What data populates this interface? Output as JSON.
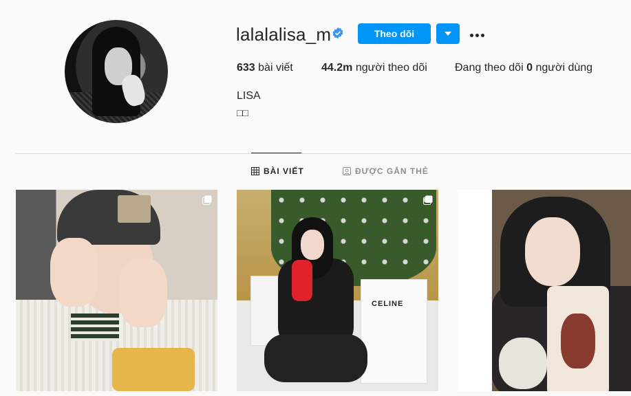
{
  "profile": {
    "username": "lalalalisa_m",
    "verified": true,
    "follow_label": "Theo dõi",
    "full_name": "LISA",
    "bio": "□□"
  },
  "stats": {
    "posts_count": "633",
    "posts_label": "bài viết",
    "followers_count": "44.2m",
    "followers_label": "người theo dõi",
    "following_prefix": "Đang theo dõi",
    "following_count": "0",
    "following_suffix": "người dùng"
  },
  "tabs": [
    {
      "label": "BÀI VIẾT",
      "active": true,
      "icon": "grid-icon"
    },
    {
      "label": "ĐƯỢC GẮN THẺ",
      "active": false,
      "icon": "tagged-icon"
    }
  ],
  "posts": [
    {
      "multi": true
    },
    {
      "multi": true,
      "bag_text": "CELINE"
    },
    {
      "multi": false
    }
  ],
  "colors": {
    "accent": "#0095f6",
    "verified": "#3897f0",
    "text": "#262626",
    "muted": "#8e8e8e",
    "background": "#fafafa"
  }
}
